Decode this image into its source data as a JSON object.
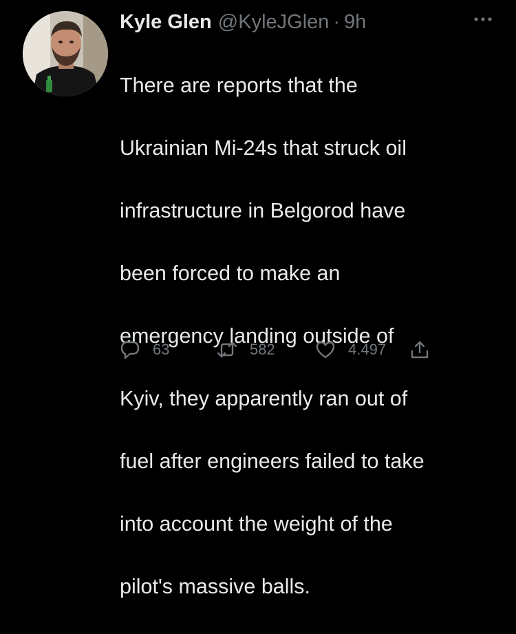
{
  "user": {
    "display_name": "Kyle Glen",
    "handle": "@KyleJGlen",
    "separator": "·",
    "time": "9h"
  },
  "tweet": {
    "text_lines": [
      "There are reports that the",
      "Ukrainian Mi-24s that struck oil",
      "infrastructure in Belgorod have",
      "been forced to make an",
      "emergency landing outside of",
      "Kyiv, they apparently ran out of",
      "fuel after engineers failed to take",
      "into account the weight of the",
      "pilot's massive balls."
    ]
  },
  "actions": {
    "reply_count": "63",
    "retweet_count": "582",
    "like_count": "4.497"
  },
  "icons": {
    "more": "more-horizontal-icon",
    "reply": "reply-bubble-icon",
    "retweet": "retweet-icon",
    "like": "heart-icon",
    "share": "share-icon"
  },
  "colors": {
    "background": "#000000",
    "text": "#e7e9ea",
    "secondary": "#71767b"
  }
}
